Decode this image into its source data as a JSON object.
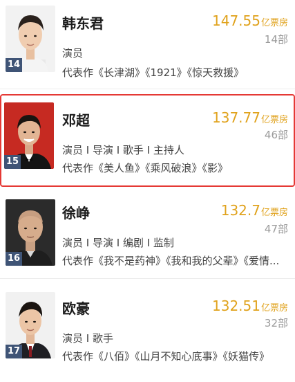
{
  "box_unit": "亿票房",
  "count_unit": "部",
  "works_prefix": "代表作",
  "people": [
    {
      "rank": "14",
      "name": "韩东君",
      "box_office": "147.55",
      "box_unit": "亿票房",
      "works_count": "14部",
      "roles": "演员",
      "works": "代表作《长津湖》《1921》《惊天救援》",
      "highlighted": false
    },
    {
      "rank": "15",
      "name": "邓超",
      "box_office": "137.77",
      "box_unit": "亿票房",
      "works_count": "46部",
      "roles": "演员 I 导演 I 歌手 I 主持人",
      "works": "代表作《美人鱼》《乘风破浪》《影》",
      "highlighted": true
    },
    {
      "rank": "16",
      "name": "徐峥",
      "box_office": "132.7",
      "box_unit": "亿票房",
      "works_count": "47部",
      "roles": "演员 I 导演 I 编剧 I 监制",
      "works": "代表作《我不是药神》《我和我的父辈》《爱情...",
      "highlighted": false
    },
    {
      "rank": "17",
      "name": "欧豪",
      "box_office": "132.51",
      "box_unit": "亿票房",
      "works_count": "32部",
      "roles": "演员 I 歌手",
      "works": "代表作《八佰》《山月不知心底事》《妖猫传》",
      "highlighted": false
    }
  ],
  "colors": {
    "accent_gold": "#e0a21c",
    "highlight_border": "#e53935",
    "rank_badge": "#3f5476",
    "muted": "#9a9a9a"
  }
}
